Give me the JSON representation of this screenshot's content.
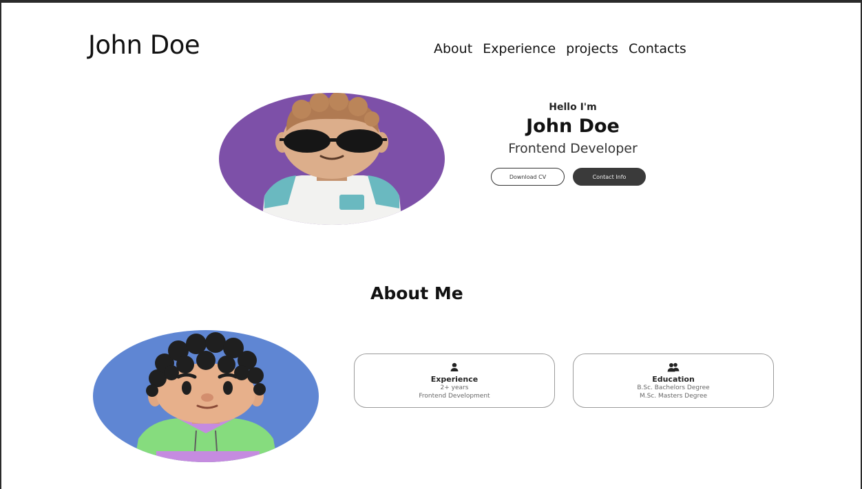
{
  "header": {
    "logo": "John Doe",
    "nav": [
      "About",
      "Experience",
      "projects",
      "Contacts"
    ]
  },
  "hero": {
    "greeting": "Hello I'm",
    "name": "John Doe",
    "role": "Frontend Developer",
    "download_cv_label": "Download CV",
    "contact_info_label": "Contact Info",
    "avatar_bg": "#7d50a8"
  },
  "about": {
    "title": "About Me",
    "avatar_bg": "#5f86d3",
    "cards": [
      {
        "icon": "experience-icon",
        "title": "Experience",
        "lines": [
          "2+ years",
          "Frontend Development"
        ]
      },
      {
        "icon": "education-icon",
        "title": "Education",
        "lines": [
          "B.Sc. Bachelors Degree",
          "M.Sc. Masters Degree"
        ]
      }
    ]
  }
}
